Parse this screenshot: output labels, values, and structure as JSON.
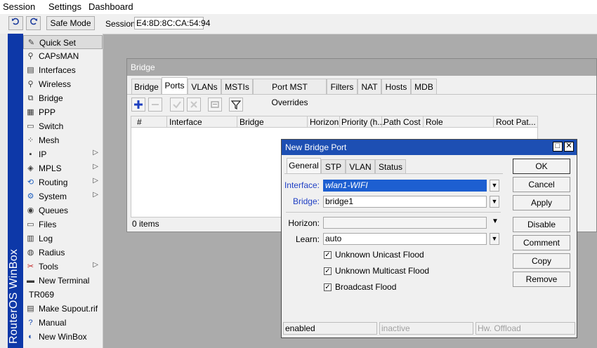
{
  "menu": {
    "items": [
      "Session",
      "Settings",
      "Dashboard"
    ]
  },
  "toolbar": {
    "undo_icon": "undo-arrow-icon",
    "redo_icon": "redo-arrow-icon",
    "safe_mode_label": "Safe Mode",
    "session_label": "Session:",
    "session_value": "E4:8D:8C:CA:54:94"
  },
  "brand": {
    "text": "RouterOS WinBox"
  },
  "sidebar": {
    "items": [
      {
        "label": "Quick Set",
        "icon": "quick-set-icon",
        "submenu": false,
        "selected": true
      },
      {
        "label": "CAPsMAN",
        "icon": "capsman-icon",
        "submenu": false
      },
      {
        "label": "Interfaces",
        "icon": "interfaces-icon",
        "submenu": false
      },
      {
        "label": "Wireless",
        "icon": "wireless-icon",
        "submenu": false
      },
      {
        "label": "Bridge",
        "icon": "bridge-icon",
        "submenu": false
      },
      {
        "label": "PPP",
        "icon": "ppp-icon",
        "submenu": false
      },
      {
        "label": "Switch",
        "icon": "switch-icon",
        "submenu": false
      },
      {
        "label": "Mesh",
        "icon": "mesh-icon",
        "submenu": false
      },
      {
        "label": "IP",
        "icon": "ip-icon",
        "submenu": true
      },
      {
        "label": "MPLS",
        "icon": "mpls-icon",
        "submenu": true
      },
      {
        "label": "Routing",
        "icon": "routing-icon",
        "submenu": true
      },
      {
        "label": "System",
        "icon": "system-icon",
        "submenu": true
      },
      {
        "label": "Queues",
        "icon": "queues-icon",
        "submenu": false
      },
      {
        "label": "Files",
        "icon": "files-icon",
        "submenu": false
      },
      {
        "label": "Log",
        "icon": "log-icon",
        "submenu": false
      },
      {
        "label": "Radius",
        "icon": "radius-icon",
        "submenu": false
      },
      {
        "label": "Tools",
        "icon": "tools-icon",
        "submenu": true
      },
      {
        "label": "New Terminal",
        "icon": "terminal-icon",
        "submenu": false
      },
      {
        "label": "TR069",
        "icon": "",
        "submenu": false
      },
      {
        "label": "Make Supout.rif",
        "icon": "supout-icon",
        "submenu": false
      },
      {
        "label": "Manual",
        "icon": "manual-icon",
        "submenu": false
      },
      {
        "label": "New WinBox",
        "icon": "winbox-icon",
        "submenu": false
      }
    ]
  },
  "bridge_window": {
    "title": "Bridge",
    "tabs": [
      "Bridge",
      "Ports",
      "VLANs",
      "MSTIs",
      "Port MST Overrides",
      "Filters",
      "NAT",
      "Hosts",
      "MDB"
    ],
    "active_tab": "Ports",
    "toolbar_icons": [
      "add-icon",
      "remove-icon",
      "enable-icon",
      "disable-icon",
      "comment-icon",
      "filter-icon"
    ],
    "columns": [
      "#",
      "Interface",
      "Bridge",
      "Horizon",
      "Priority (h...",
      "Path Cost",
      "Role",
      "Root Pat..."
    ],
    "item_count": "0 items"
  },
  "dialog": {
    "title": "New Bridge Port",
    "tabs": [
      "General",
      "STP",
      "VLAN",
      "Status"
    ],
    "active_tab": "General",
    "fields": {
      "interface_label": "Interface:",
      "interface_value": "wlan1-WIFI",
      "bridge_label": "Bridge:",
      "bridge_value": "bridge1",
      "horizon_label": "Horizon:",
      "horizon_value": "",
      "learn_label": "Learn:",
      "learn_value": "auto"
    },
    "checkboxes": [
      {
        "label": "Unknown Unicast Flood",
        "checked": true
      },
      {
        "label": "Unknown Multicast Flood",
        "checked": true
      },
      {
        "label": "Broadcast Flood",
        "checked": true
      }
    ],
    "buttons": [
      "OK",
      "Cancel",
      "Apply",
      "Disable",
      "Comment",
      "Copy",
      "Remove"
    ],
    "status": [
      "enabled",
      "inactive",
      "Hw. Offload"
    ]
  },
  "colors": {
    "brand_blue": "#0d38a8",
    "dialog_title": "#1d4fb3",
    "label_blue": "#1f3fc4",
    "selection": "#1d5fd1"
  }
}
